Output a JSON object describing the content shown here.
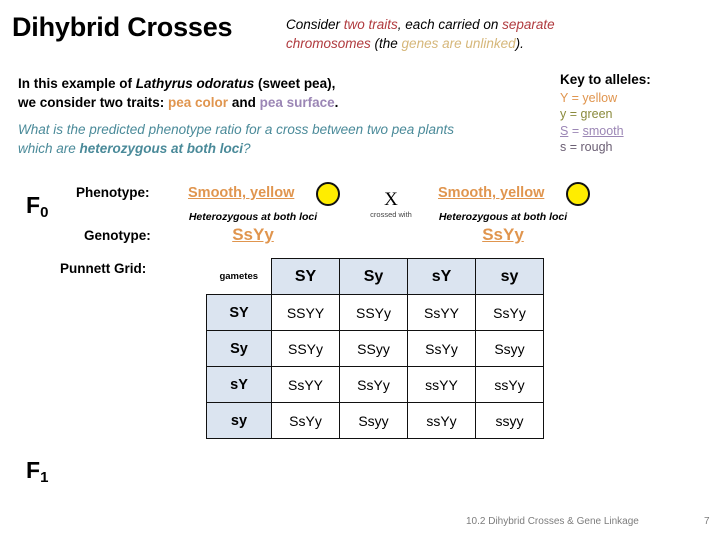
{
  "slide": {
    "title": "Dihybrid Crosses",
    "subtitle": {
      "part1": "Consider ",
      "highlight1": "two traits",
      "part2": ", each carried on ",
      "highlight2": "separate chromosomes",
      "part3": " (the ",
      "highlight3": "genes are unlinked",
      "part4": ")."
    },
    "intro": {
      "part1": "In this example of ",
      "species": "Lathyrus odoratus",
      "part2": " (sweet pea),",
      "part3": "we consider two traits: ",
      "trait1": "pea color",
      "part4": " and ",
      "trait2": "pea surface",
      "part5": "."
    },
    "question": {
      "part1": "What is the predicted phenotype ratio for a cross between two pea plants which are ",
      "emphasis": "heterozygous at both loci",
      "part2": "?"
    },
    "key": {
      "title": "Key to alleles:",
      "rows": [
        {
          "symbol": "Y",
          "equals": " = ",
          "meaning": "yellow"
        },
        {
          "symbol": "y",
          "equals": " = ",
          "meaning": "green"
        },
        {
          "symbol": "S",
          "equals": " = ",
          "meaning": "smooth"
        },
        {
          "symbol": "s",
          "equals": " = ",
          "meaning": "rough"
        }
      ]
    },
    "generations": {
      "f0": "F",
      "f0_sub": "0",
      "f1": "F",
      "f1_sub": "1"
    },
    "labels": {
      "phenotype": "Phenotype:",
      "genotype": "Genotype:",
      "punnett": "Punnett Grid:"
    },
    "parent_left": {
      "phenotype": "Smooth, yellow",
      "note": "Heterozygous at both loci",
      "genotype": "SsYy"
    },
    "parent_right": {
      "phenotype": "Smooth, yellow",
      "note": "Heterozygous at both loci",
      "genotype": "SsYy"
    },
    "cross": {
      "symbol": "X",
      "caption": "crossed with"
    },
    "punnett": {
      "corner": "gametes",
      "col_headers": [
        "SY",
        "Sy",
        "sY",
        "sy"
      ],
      "row_headers": [
        "SY",
        "Sy",
        "sY",
        "sy"
      ],
      "cells": [
        [
          "SSYY",
          "SSYy",
          "SsYY",
          "SsYy"
        ],
        [
          "SSYy",
          "SSyy",
          "SsYy",
          "Ssyy"
        ],
        [
          "SsYY",
          "SsYy",
          "ssYY",
          "ssYy"
        ],
        [
          "SsYy",
          "Ssyy",
          "ssYy",
          "ssyy"
        ]
      ]
    },
    "footer": {
      "text": "10.2 Dihybrid Crosses & Gene Linkage",
      "page": "7"
    },
    "colors": {
      "red": "#b03a3e",
      "tan": "#d6b77a",
      "orange": "#e0954e",
      "purple": "#9b86b5",
      "olive": "#8a8a3c",
      "dark_purple": "#6b5f74",
      "teal": "#4a8a99",
      "pea_yellow": "#ffed00",
      "header_blue": "#dbe4f0"
    }
  }
}
